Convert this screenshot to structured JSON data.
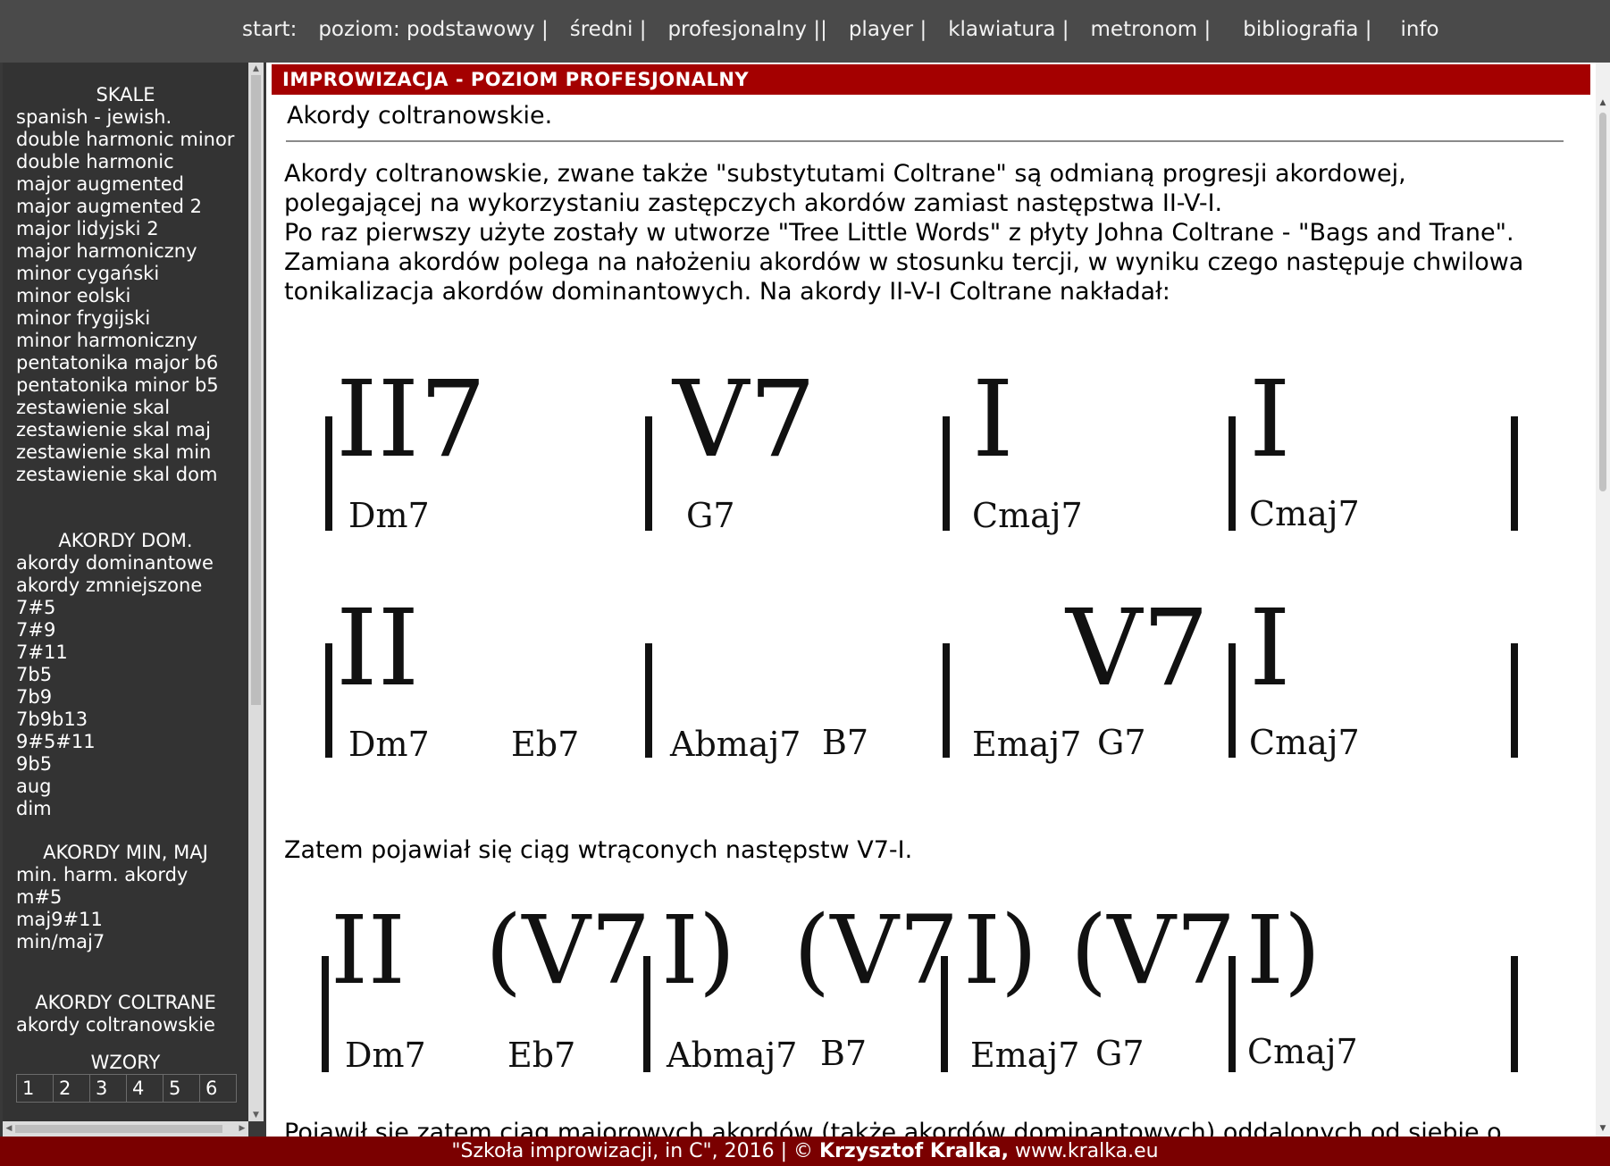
{
  "nav": {
    "items": [
      "start:",
      "poziom: podstawowy |",
      "średni |",
      "profesjonalny ||",
      "player |",
      "klawiatura |",
      "metronom |",
      "bibliografia |",
      "info"
    ]
  },
  "sidebar": {
    "sections": [
      {
        "title": "SKALE",
        "links": [
          "spanish - jewish.",
          "double harmonic minor",
          "double harmonic",
          "major augmented",
          "major augmented 2",
          "major lidyjski 2",
          "major harmoniczny",
          "minor cygański",
          "minor eolski",
          "minor frygijski",
          "minor harmoniczny",
          "pentatonika major b6",
          "pentatonika minor b5",
          "zestawienie skal",
          "zestawienie skal maj",
          "zestawienie skal min",
          "zestawienie skal dom"
        ]
      },
      {
        "title": "AKORDY DOM.",
        "links": [
          "akordy dominantowe",
          "akordy zmniejszone",
          "7#5",
          "7#9",
          "7#11",
          "7b5",
          "7b9",
          "7b9b13",
          "9#5#11",
          "9b5",
          "aug",
          "dim"
        ]
      },
      {
        "title": "AKORDY MIN, MAJ",
        "links": [
          "min. harm. akordy",
          "m#5",
          "maj9#11",
          "min/maj7"
        ]
      },
      {
        "title": "AKORDY COLTRANE",
        "links": [
          "akordy coltranowskie"
        ]
      },
      {
        "title": "WZORY",
        "cells": [
          "1",
          "2",
          "3",
          "4",
          "5",
          "6"
        ]
      }
    ]
  },
  "main": {
    "header": "IMPROWIZACJA - POZIOM PROFESJONALNY",
    "subtitle": "Akordy coltranowskie.",
    "paragraph": [
      "Akordy coltranowskie, zwane także \"substytutami Coltrane\" są odmianą progresji akordowej,",
      "polegającej na wykorzystaniu zastępczych akordów zamiast następstwa II-V-I.",
      "Po raz pierwszy użyte zostały w utworze \"Tree Little Words\" z płyty Johna Coltrane - \"Bags and Trane\".",
      "Zamiana akordów polega na nałożeniu akordów w stosunku tercji, w wyniku czego następuje chwilowa",
      "tonikalizacja akordów dominantowych. Na akordy II-V-I Coltrane nakładał:"
    ],
    "between_text": "Zatem pojawiał się ciąg wtrąconych następstw V7-I.",
    "cut_text": "Pojawił się zatem ciąg majorowych akordów (także akordów dominantowych) oddalonych od siebie o",
    "chords": {
      "row1_numerals": [
        "II7",
        "V7",
        "I",
        "I"
      ],
      "row1_names": [
        "Dm7",
        "G7",
        "Cmaj7",
        "Cmaj7"
      ],
      "row2_numerals": [
        "II",
        "V7",
        "I"
      ],
      "row2_names": [
        "Dm7",
        "Eb7",
        "Abmaj7",
        "B7",
        "Emaj7",
        "G7",
        "Cmaj7"
      ],
      "row3_numerals": [
        "II",
        "(V7",
        "I)",
        "(V7",
        "I)",
        "(V7",
        "I)"
      ],
      "row3_names": [
        "Dm7",
        "Eb7",
        "Abmaj7",
        "B7",
        "Emaj7",
        "G7",
        "Cmaj7"
      ]
    }
  },
  "footer": {
    "prefix": "\"Szkoła improwizacji, in C\", 2016 | © ",
    "author": "Krzysztof Kralka,",
    "site": " www.kralka.eu"
  },
  "colors": {
    "topbar": "#4a4a4a",
    "sidebar": "#333333",
    "header_red": "#a40000",
    "footer_red": "#7a0000"
  }
}
